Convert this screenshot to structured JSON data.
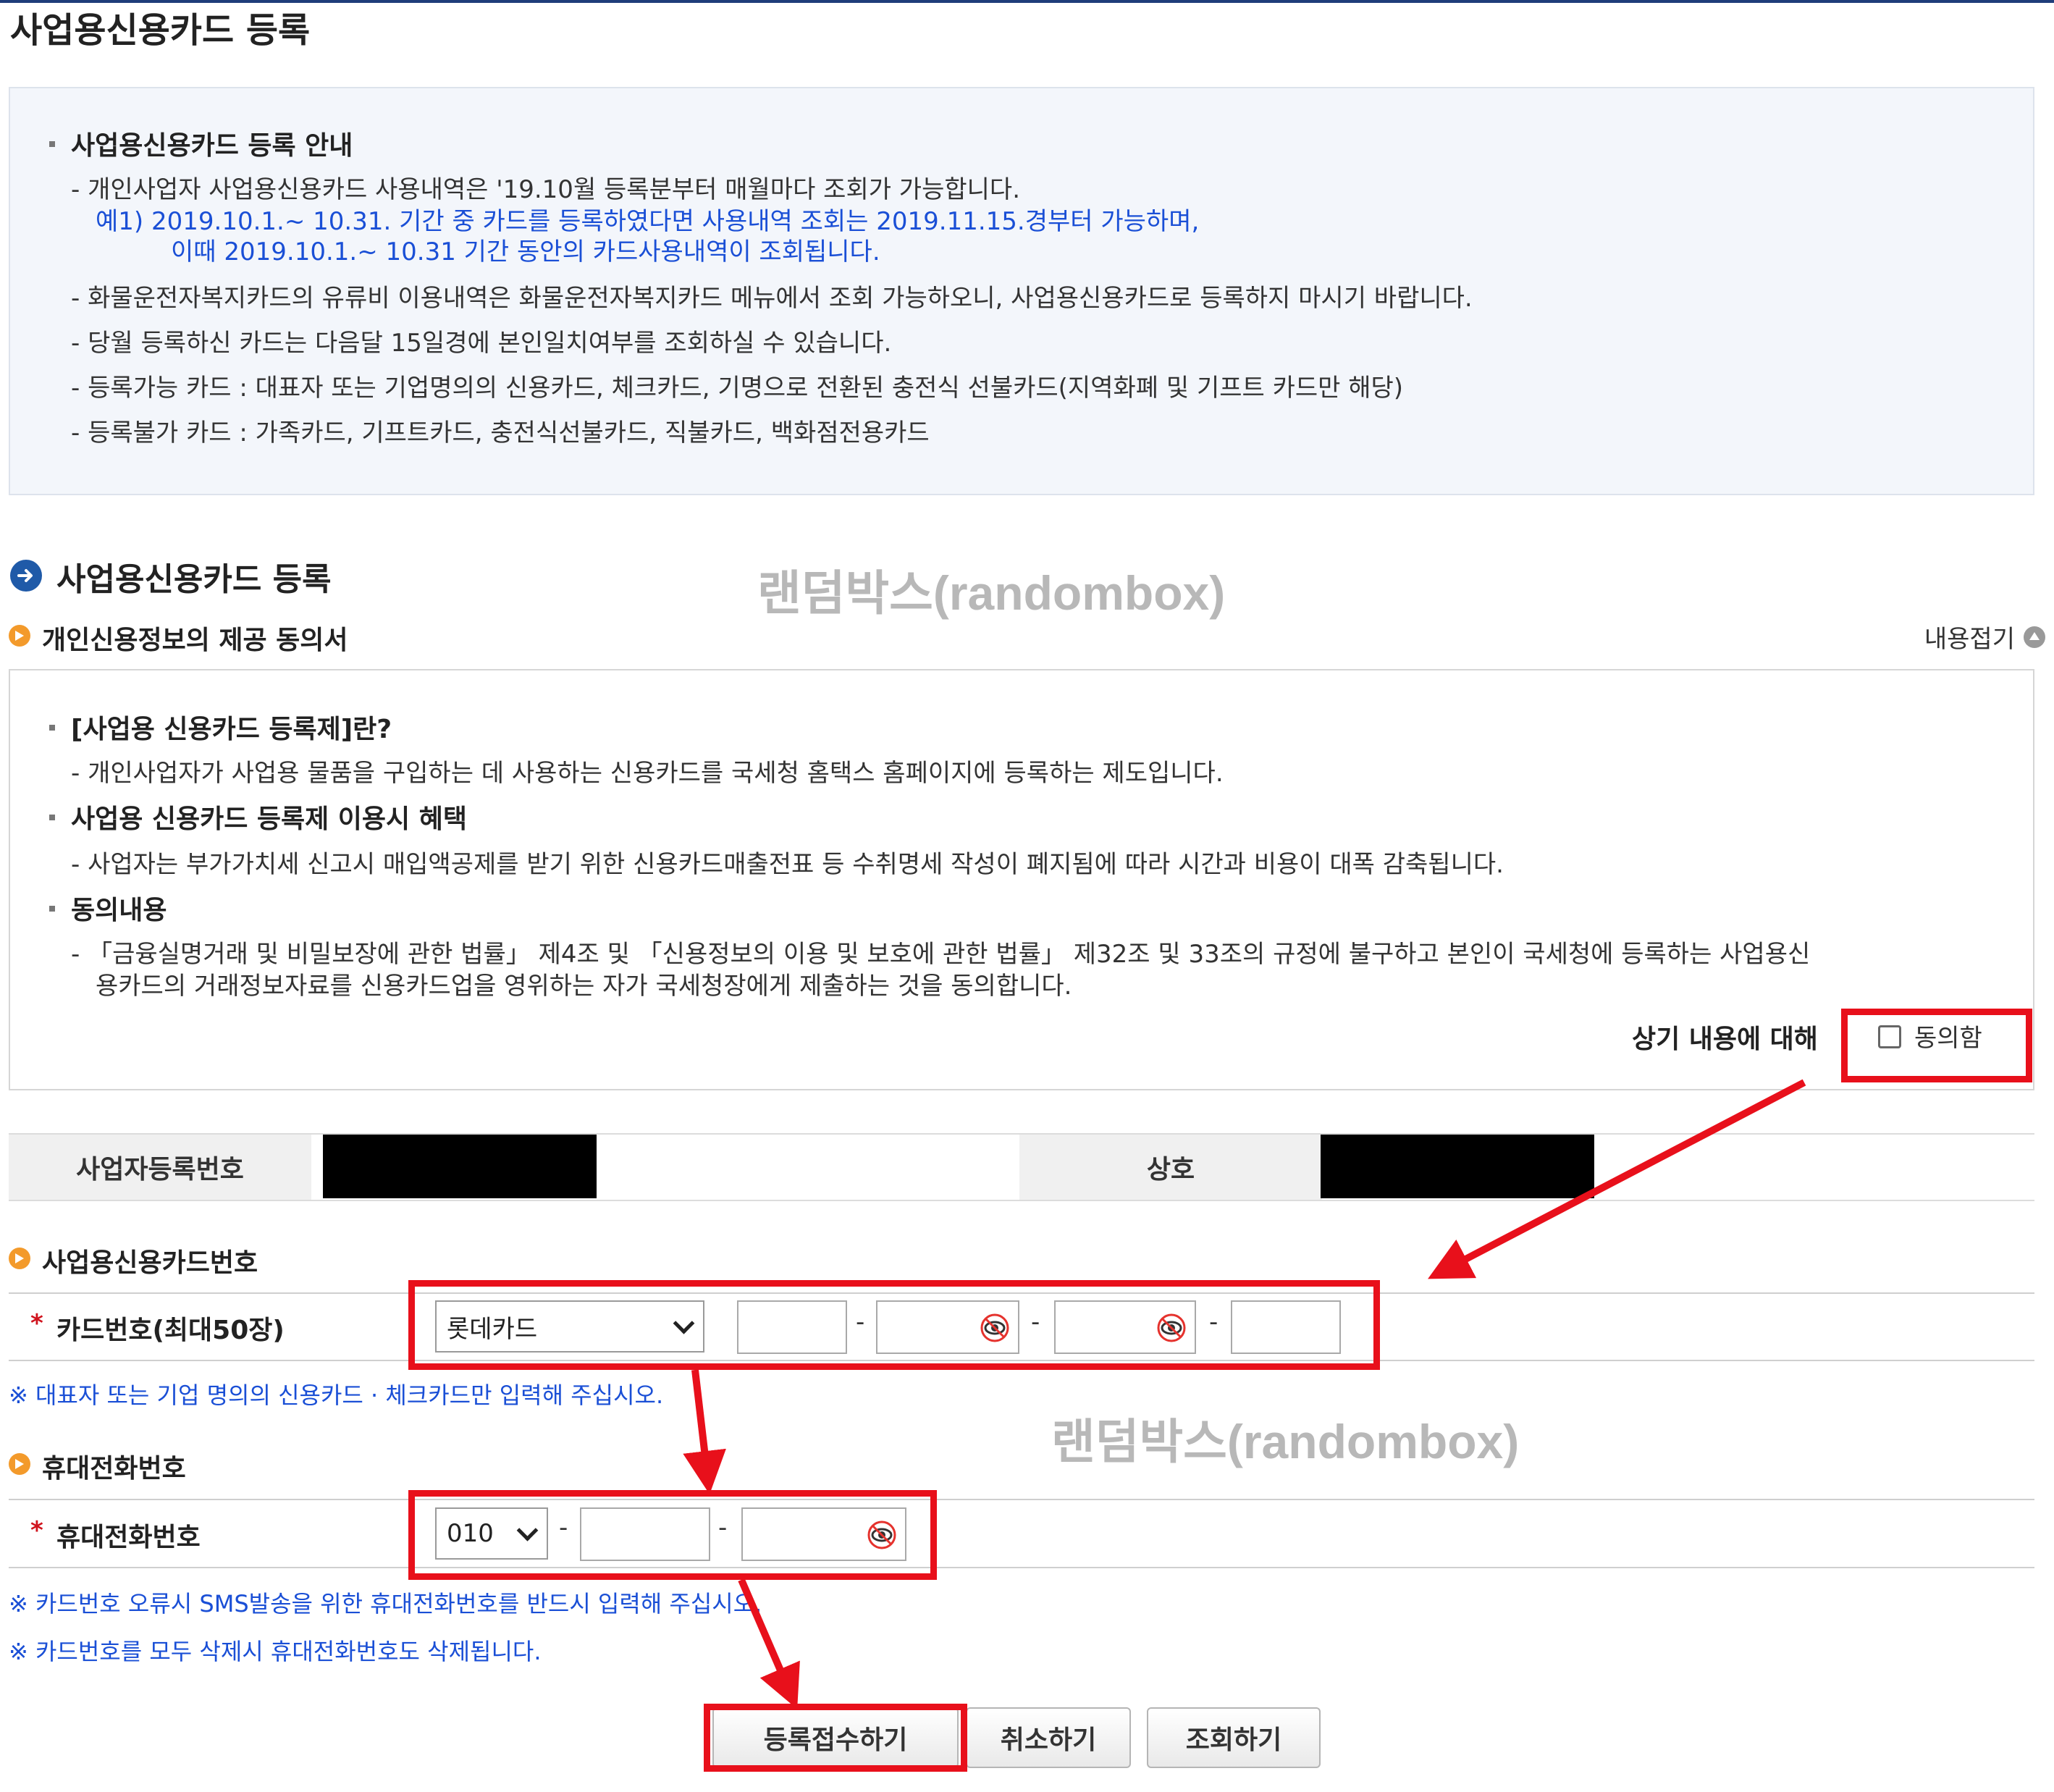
{
  "page_title": "사업용신용카드 등록",
  "info": {
    "heading": "사업용신용카드 등록 안내",
    "line1": "- 개인사업자 사업용신용카드 사용내역은 '19.10월 등록분부터 매월마다 조회가 가능합니다.",
    "example1": "예1) 2019.10.1.~ 10.31. 기간 중 카드를 등록하였다면 사용내역 조회는 2019.11.15.경부터 가능하며,",
    "example2": "이때 2019.10.1.~ 10.31 기간 동안의 카드사용내역이 조회됩니다.",
    "line2": "- 화물운전자복지카드의 유류비 이용내역은 화물운전자복지카드 메뉴에서 조회 가능하오니, 사업용신용카드로 등록하지 마시기 바랍니다.",
    "line3": "- 당월 등록하신 카드는 다음달 15일경에 본인일치여부를 조회하실 수 있습니다.",
    "line4": "- 등록가능 카드 : 대표자 또는 기업명의의 신용카드, 체크카드, 기명으로 전환된 충전식 선불카드(지역화폐 및 기프트 카드만 해당)",
    "line5": "- 등록불가 카드 : 가족카드, 기프트카드, 충전식선불카드, 직불카드, 백화점전용카드"
  },
  "section_title": "사업용신용카드 등록",
  "watermark": "랜덤박스(randombox)",
  "consent": {
    "title": "개인신용정보의 제공 동의서",
    "collapse_label": "내용접기",
    "h1": "[사업용 신용카드 등록제]란?",
    "p1": "- 개인사업자가 사업용 물품을 구입하는 데 사용하는 신용카드를 국세청 홈택스 홈페이지에 등록하는 제도입니다.",
    "h2": "사업용 신용카드 등록제 이용시 혜택",
    "p2": "- 사업자는 부가가치세 신고시 매입액공제를 받기 위한 신용카드매출전표 등 수취명세 작성이 폐지됨에 따라 시간과 비용이 대폭 감축됩니다.",
    "h3": "동의내용",
    "p3a": "- 「금융실명거래 및 비밀보장에 관한 법률」 제4조 및 「신용정보의 이용 및 보호에 관한 법률」 제32조 및 33조의 규정에 불구하고 본인이 국세청에 등록하는 사업용신",
    "p3b": "용카드의   거래정보자료를 신용카드업을 영위하는 자가 국세청장에게 제출하는 것을 동의합니다.",
    "agree_prefix": "상기 내용에 대해",
    "agree_label": "동의함"
  },
  "business": {
    "reg_no_label": "사업자등록번호",
    "name_label": "상호"
  },
  "card": {
    "section_title": "사업용신용카드번호",
    "row_label": "카드번호(최대50장)",
    "required_mark": "*",
    "issuer_selected": "롯데카드",
    "note": "※ 대표자 또는 기업 명의의 신용카드 · 체크카드만 입력해 주십시오."
  },
  "phone": {
    "section_title": "휴대전화번호",
    "row_label": "휴대전화번호",
    "required_mark": "*",
    "prefix_selected": "010",
    "note1": "※ 카드번호 오류시 SMS발송을 위한 휴대전화번호를 반드시 입력해 주십시오.",
    "note2": "※ 카드번호를 모두 삭제시 휴대전화번호도 삭제됩니다."
  },
  "buttons": {
    "submit": "등록접수하기",
    "cancel": "취소하기",
    "inquire": "조회하기"
  },
  "colors": {
    "highlight_red": "#e8101b",
    "link_blue": "#1a4fd6",
    "section_blue": "#1f5aa8",
    "bullet_orange": "#f39a2b"
  },
  "icons": [
    "arrow-right-icon",
    "bullet-arrow-icon",
    "collapse-up-icon",
    "eye-icon",
    "chevron-down-icon"
  ]
}
